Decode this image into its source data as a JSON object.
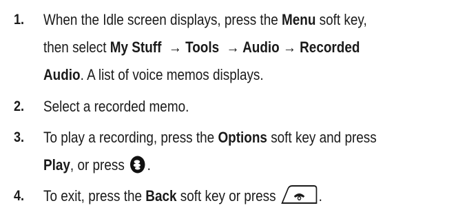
{
  "steps": [
    {
      "number": "1.",
      "lines": [
        [
          "When the Idle screen displays, press the ",
          "Menu",
          " soft key,"
        ],
        [
          "then select ",
          "My Stuff  → Tools  → Audio → Recorded",
          ""
        ],
        [
          "",
          "Audio",
          ". A list of voice memos displays."
        ]
      ]
    },
    {
      "number": "2.",
      "text": " Select a recorded memo."
    },
    {
      "number": "3.",
      "line1": [
        "To play a recording, press the ",
        "Options",
        " soft key and press"
      ],
      "line2": [
        "",
        "Play",
        ", or press ",
        "."
      ],
      "icon": "center-select-key-icon"
    },
    {
      "number": "4.",
      "line": [
        "To exit, press the ",
        "Back",
        " soft key or press ",
        "."
      ],
      "icon": "end-key-icon"
    }
  ]
}
